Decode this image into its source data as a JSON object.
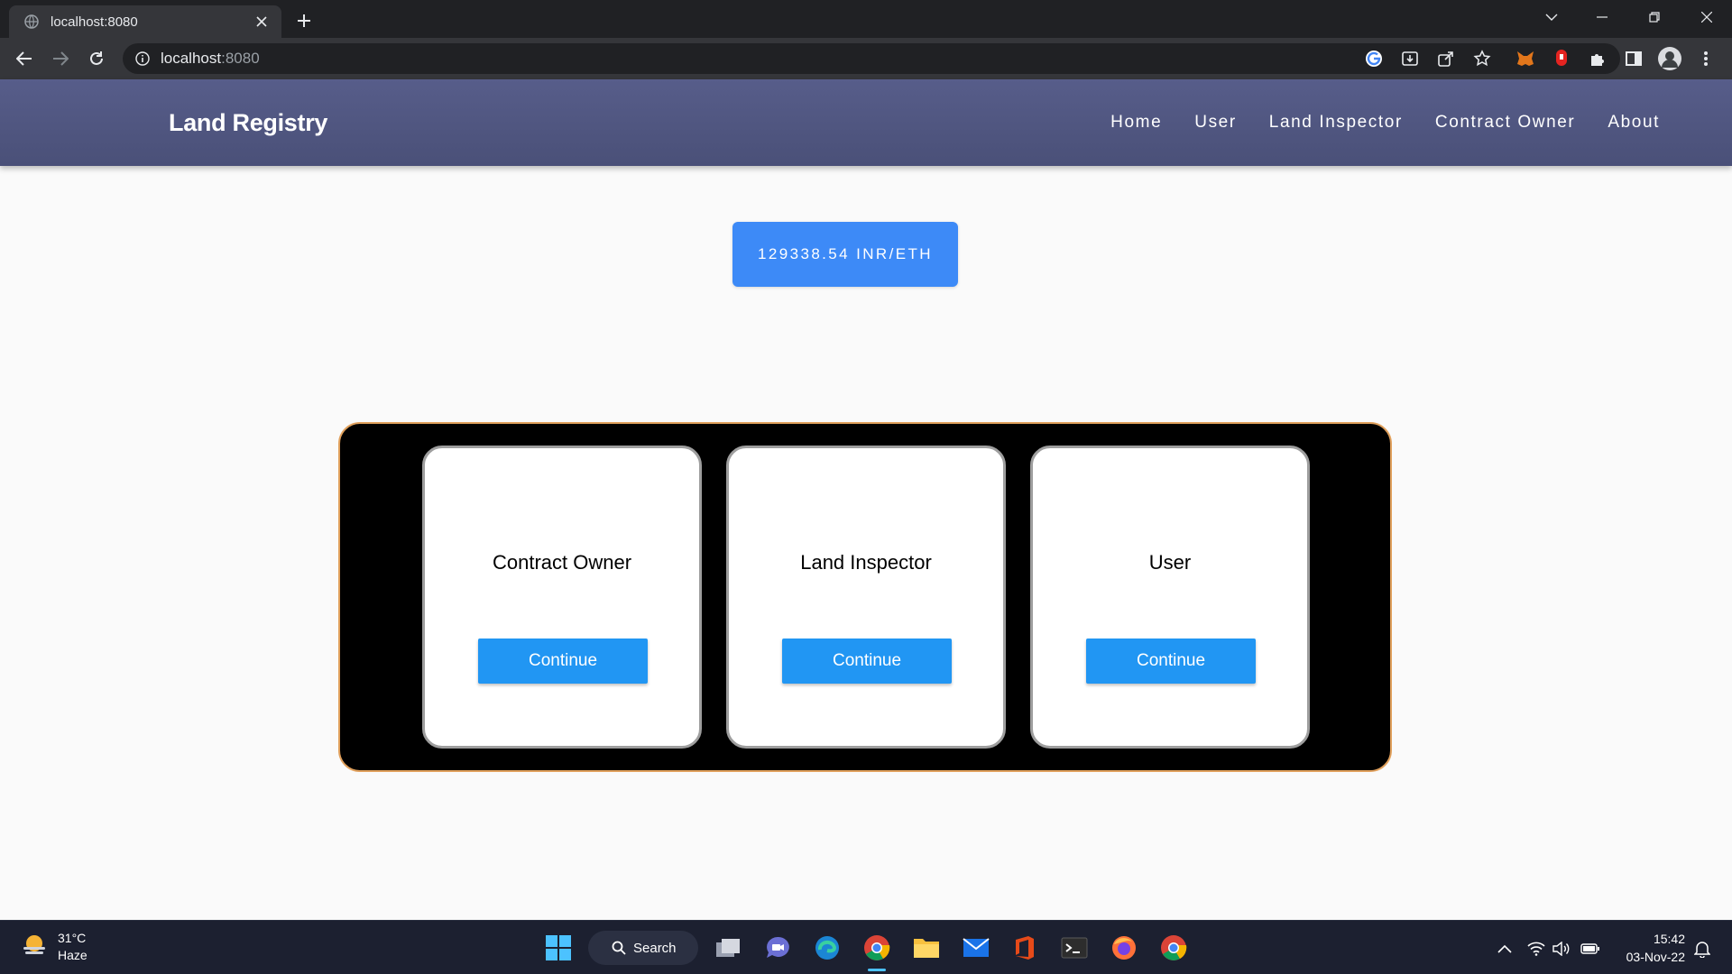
{
  "browser": {
    "tab_title": "localhost:8080",
    "url_host": "localhost",
    "url_port": ":8080"
  },
  "site": {
    "brand": "Land Registry",
    "nav": [
      "Home",
      "User",
      "Land Inspector",
      "Contract Owner",
      "About"
    ],
    "rate": "129338.54 INR/ETH",
    "cards": [
      {
        "title": "Contract Owner",
        "button": "Continue"
      },
      {
        "title": "Land Inspector",
        "button": "Continue"
      },
      {
        "title": "User",
        "button": "Continue"
      }
    ]
  },
  "taskbar": {
    "weather_temp": "31°C",
    "weather_desc": "Haze",
    "search_label": "Search",
    "time": "15:42",
    "date": "03-Nov-22"
  },
  "colors": {
    "nav_bg": "#4a5078",
    "rate_button": "#3d8af7",
    "continue_button": "#2196f3",
    "cards_border": "#e0a05c"
  }
}
